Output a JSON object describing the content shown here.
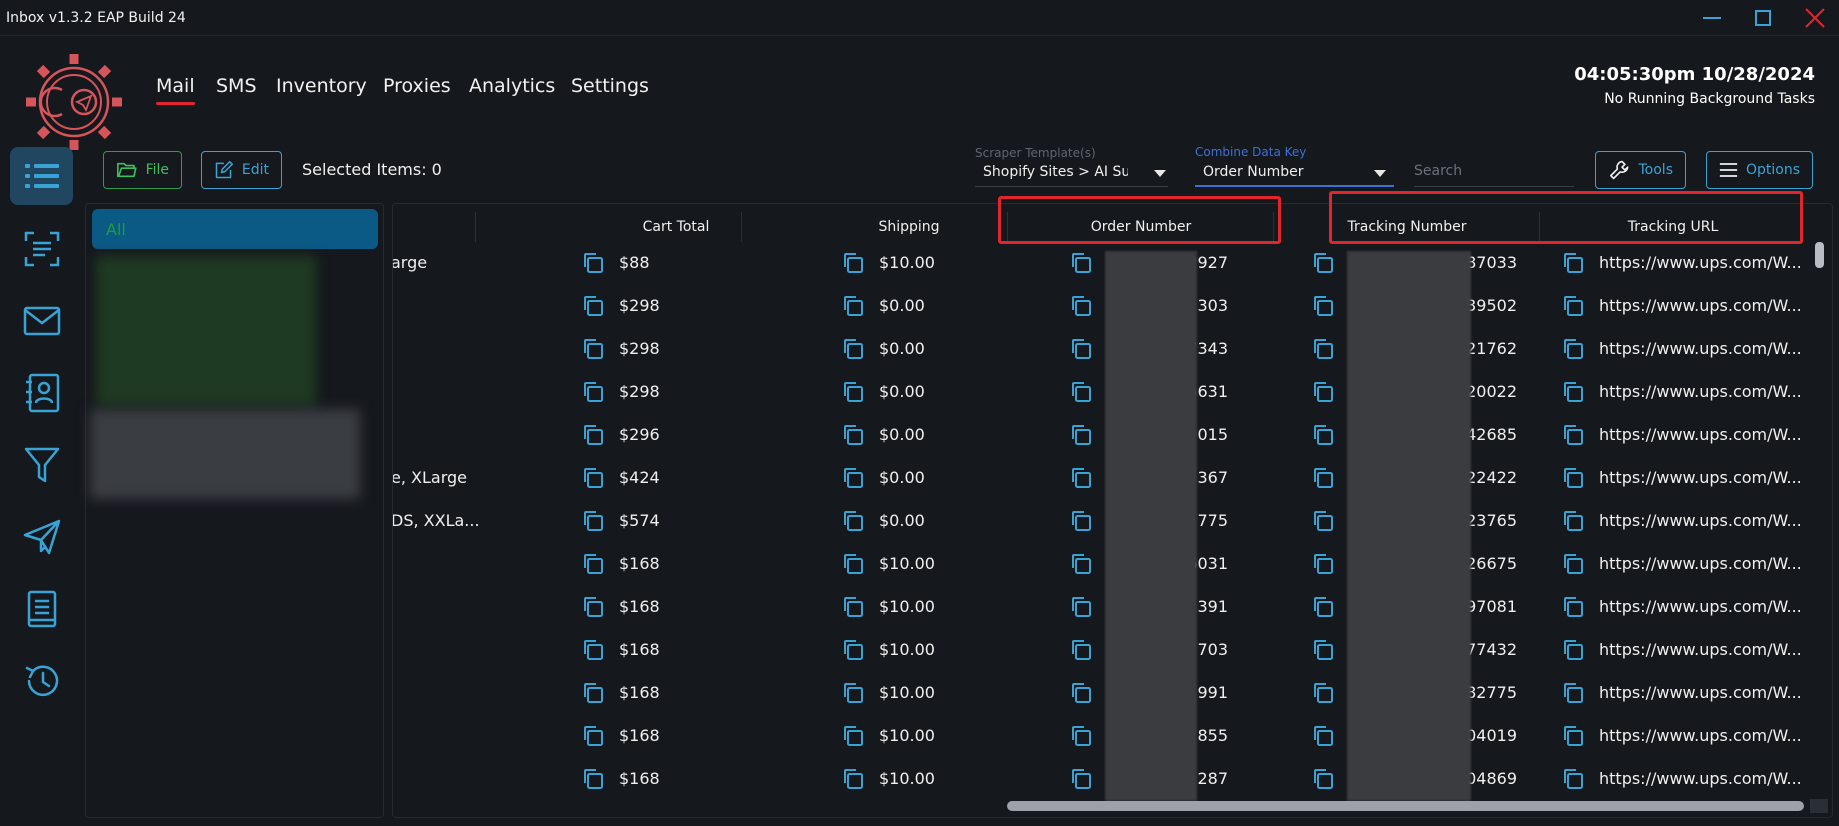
{
  "window": {
    "title": "Inbox v1.3.2 EAP Build 24"
  },
  "nav": {
    "items": [
      {
        "label": "Mail",
        "active": true
      },
      {
        "label": "SMS"
      },
      {
        "label": "Inventory"
      },
      {
        "label": "Proxies"
      },
      {
        "label": "Analytics"
      },
      {
        "label": "Settings"
      }
    ]
  },
  "header": {
    "clock": "04:05:30pm 10/28/2024",
    "status": "No Running Background Tasks"
  },
  "sidebar": {
    "icons": [
      "list-icon",
      "scan-document-icon",
      "mail-icon",
      "contacts-icon",
      "filter-icon",
      "send-icon",
      "book-icon",
      "history-icon"
    ]
  },
  "toolbar": {
    "file_label": "File",
    "edit_label": "Edit",
    "selected_items": "Selected Items: 0",
    "scraper_label": "Scraper Template(s)",
    "scraper_value": "Shopify Sites > AI Su...",
    "combine_label": "Combine Data Key",
    "combine_value": "Order Number",
    "search_placeholder": "Search",
    "tools_label": "Tools",
    "options_label": "Options"
  },
  "filters": {
    "all_label": "All"
  },
  "table": {
    "columns": [
      "Cart Total",
      "Shipping",
      "Order Number",
      "Tracking Number",
      "Tracking URL"
    ],
    "rows": [
      {
        "partial": "arge",
        "cart": "$88",
        "ship": "$10.00",
        "order": "2927",
        "tracking": "87033",
        "url": "https://www.ups.com/W..."
      },
      {
        "partial": "",
        "cart": "$298",
        "ship": "$0.00",
        "order": "303",
        "tracking": "39502",
        "url": "https://www.ups.com/W..."
      },
      {
        "partial": "",
        "cart": "$298",
        "ship": "$0.00",
        "order": "7343",
        "tracking": "521762",
        "url": "https://www.ups.com/W..."
      },
      {
        "partial": "",
        "cart": "$298",
        "ship": "$0.00",
        "order": "5631",
        "tracking": "20022",
        "url": "https://www.ups.com/W..."
      },
      {
        "partial": "",
        "cart": "$296",
        "ship": "$0.00",
        "order": "015",
        "tracking": "42685",
        "url": "https://www.ups.com/W..."
      },
      {
        "partial": "e, XLarge",
        "cart": "$424",
        "ship": "$0.00",
        "order": "367",
        "tracking": "22422",
        "url": "https://www.ups.com/W..."
      },
      {
        "partial": "DS, XXLa...",
        "cart": "$574",
        "ship": "$0.00",
        "order": "775",
        "tracking": "23765",
        "url": "https://www.ups.com/W..."
      },
      {
        "partial": "",
        "cart": "$168",
        "ship": "$10.00",
        "order": "6031",
        "tracking": "26675",
        "url": "https://www.ups.com/W..."
      },
      {
        "partial": "",
        "cart": "$168",
        "ship": "$10.00",
        "order": "391",
        "tracking": "97081",
        "url": "https://www.ups.com/W..."
      },
      {
        "partial": "",
        "cart": "$168",
        "ship": "$10.00",
        "order": "703",
        "tracking": "77432",
        "url": "https://www.ups.com/W..."
      },
      {
        "partial": "",
        "cart": "$168",
        "ship": "$10.00",
        "order": "991",
        "tracking": "82775",
        "url": "https://www.ups.com/W..."
      },
      {
        "partial": "",
        "cart": "$168",
        "ship": "$10.00",
        "order": "855",
        "tracking": "04019",
        "url": "https://www.ups.com/W..."
      },
      {
        "partial": "",
        "cart": "$168",
        "ship": "$10.00",
        "order": "287",
        "tracking": "04869",
        "url": "https://www.ups.com/W..."
      }
    ]
  },
  "colors": {
    "accent": "#3aa3d6",
    "highlight": "#e0252c",
    "green": "#3cbf5e"
  }
}
